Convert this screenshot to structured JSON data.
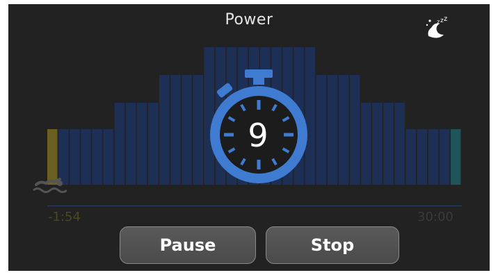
{
  "screen": {
    "title": "Power",
    "sleep_icon": "sleep-mode-icon",
    "countdown": "9",
    "elapsed_label": "-1:54",
    "end_label": "30:00",
    "pause_label": "Pause",
    "stop_label": "Stop"
  },
  "colors": {
    "background": "#222222",
    "bar_main": "#1e2f55",
    "bar_warmup": "#6b6020",
    "bar_cooldown": "#1f5458",
    "timer_blue": "#3f7bd0"
  },
  "chart_data": {
    "type": "bar",
    "values": [
      1,
      1,
      1,
      1,
      1,
      1,
      2,
      2,
      2,
      2,
      3,
      3,
      3,
      3,
      4,
      4,
      4,
      4,
      4,
      4,
      4,
      4,
      4,
      4,
      3,
      3,
      3,
      3,
      2,
      2,
      2,
      2,
      1,
      1,
      1,
      1,
      1
    ],
    "first_bar": "warm-up",
    "last_bar": "cool-down"
  }
}
